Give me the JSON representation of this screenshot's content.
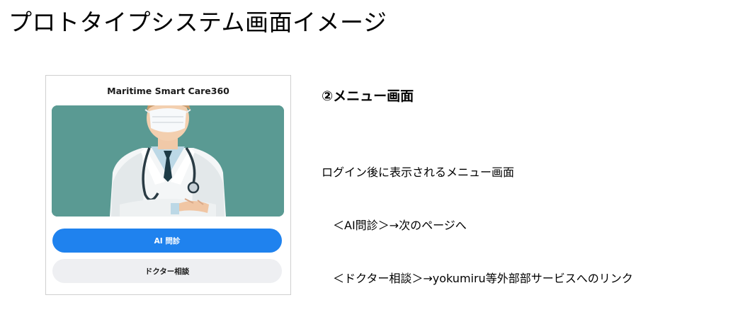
{
  "page": {
    "title": "プロトタイプシステム画面イメージ"
  },
  "app": {
    "title": "Maritime Smart Care360",
    "hero_image": "doctor-illustration",
    "buttons": {
      "ai_label": "AI 問診",
      "doctor_label": "ドクター相談"
    },
    "colors": {
      "primary": "#1f82ee",
      "secondary": "#eeeff2",
      "hero_bg": "#5a9a93"
    }
  },
  "description": {
    "heading": "②メニュー画面",
    "lines": [
      "ログイン後に表示されるメニュー画面",
      "　＜AI問診＞→次のページへ",
      "　＜ドクター相談＞→yokumiru等外部部サービスへのリンク"
    ]
  }
}
